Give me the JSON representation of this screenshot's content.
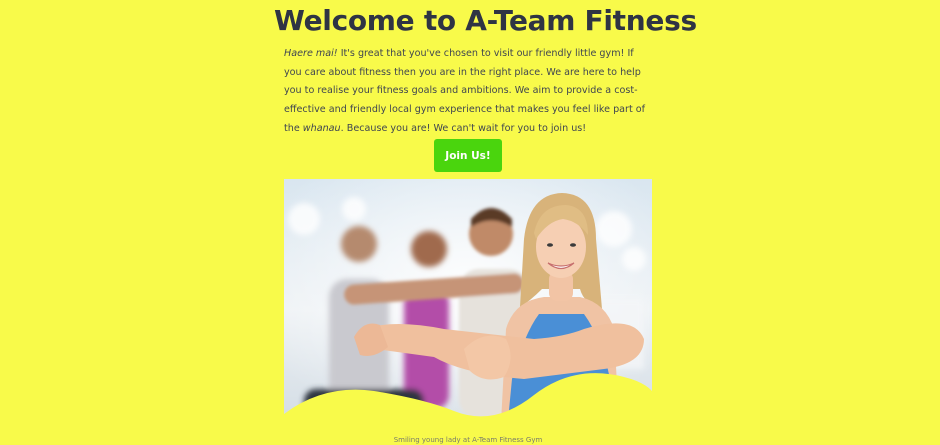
{
  "header": {
    "title": "Welcome to A-Team Fitness"
  },
  "intro": {
    "greeting": "Haere mai!",
    "part1": " It's great that you've chosen to visit our friendly little gym! If you care about fitness then you are in the right place. We are here to help you to realise your fitness goals and ambitions. We aim to provide a cost-effective and friendly local gym experience that makes you feel like part of the ",
    "whanau": "whanau",
    "part2": ". Because you are! We can't wait for you to join us!"
  },
  "cta": {
    "join_label": "Join Us!"
  },
  "hero_image": {
    "caption": "Smiling young lady at A-Team Fitness Gym"
  },
  "colors": {
    "background": "#f8fa4a",
    "button": "#4ad50d",
    "title": "#2f3444"
  }
}
